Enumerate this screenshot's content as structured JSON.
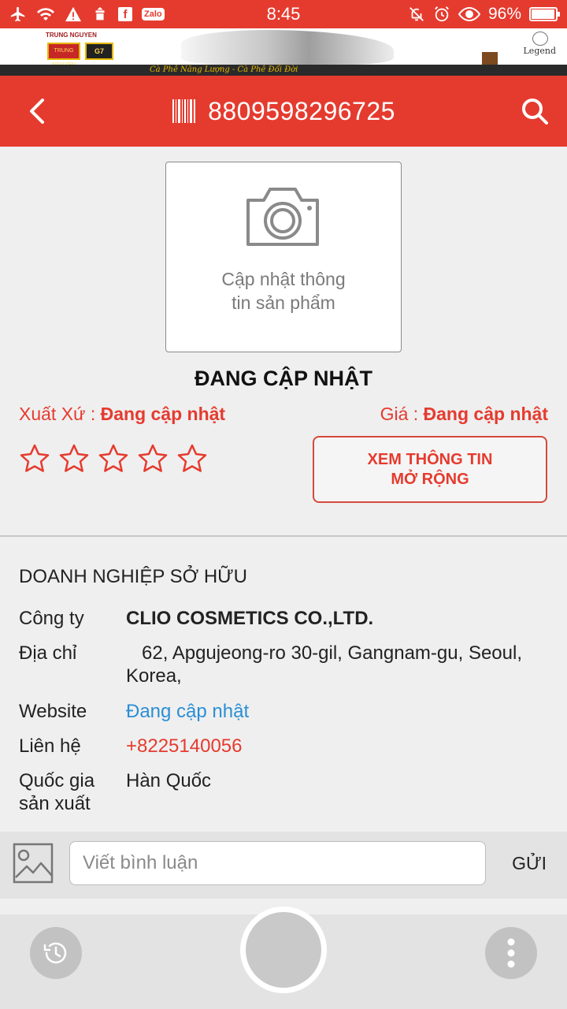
{
  "status_bar": {
    "time": "8:45",
    "battery": "96%",
    "battery_level": 0.96,
    "zalo_label": "Zalo",
    "fb_label": "f"
  },
  "banner": {
    "brand": "TRUNG NGUYEN",
    "product1": "TRUNG NGUYEN",
    "product2": "G7",
    "legend": "Legend",
    "tagline": "Cà Phê Năng Lượng - Cà Phê Đổi Đời"
  },
  "header": {
    "barcode": "8809598296725"
  },
  "product": {
    "image_placeholder_line1": "Cập nhật thông",
    "image_placeholder_line2": "tin sản phẩm",
    "name": "ĐANG CẬP NHẬT",
    "origin_label": "Xuất Xứ :",
    "origin_value": "Đang cập nhật",
    "price_label": "Giá :",
    "price_value": "Đang cập nhật",
    "rating": 0,
    "rating_max": 5,
    "more_info_line1": "XEM THÔNG TIN",
    "more_info_line2": "MỞ RỘNG"
  },
  "owner": {
    "section_title": "DOANH NGHIỆP SỞ HỮU",
    "company_label": "Công ty",
    "company_value": "CLIO COSMETICS CO.,LTD.",
    "address_label": "Địa chỉ",
    "address_value": "62, Apgujeong-ro 30-gil, Gangnam-gu, Seoul, Korea,",
    "website_label": "Website",
    "website_value": "Đang cập nhật",
    "contact_label": "Liên hệ",
    "contact_value": "+8225140056",
    "country_label_line1": "Quốc gia",
    "country_label_line2": "sản xuất",
    "country_value": "Hàn Quốc"
  },
  "comment": {
    "placeholder": "Viết bình luận",
    "send_label": "GỬI"
  },
  "colors": {
    "primary": "#e53b2f",
    "link": "#2a8fd6"
  }
}
